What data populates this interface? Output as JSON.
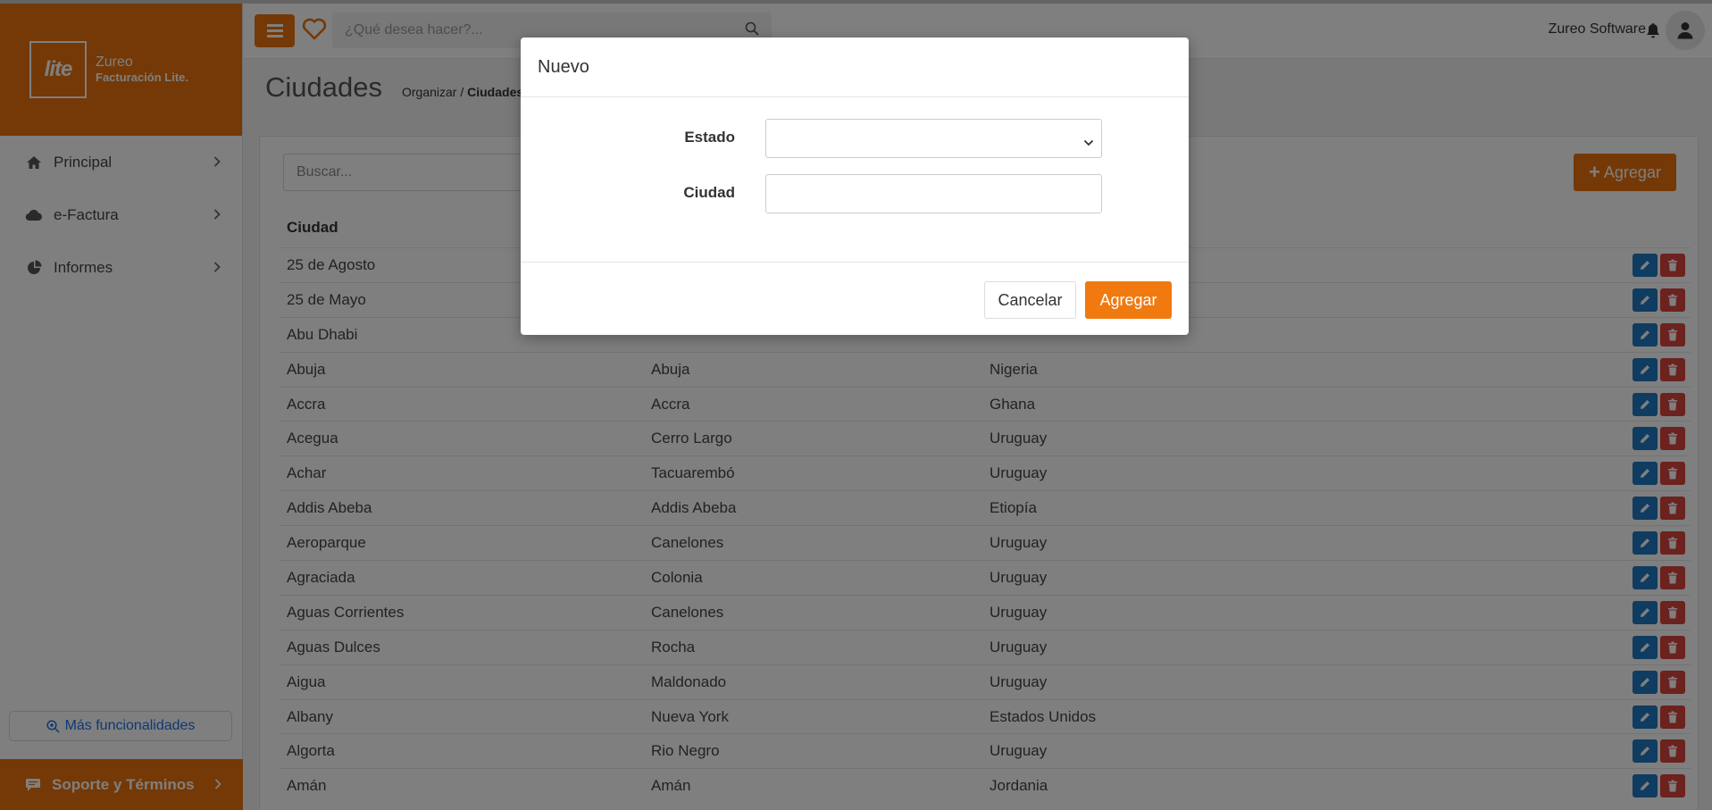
{
  "brand": {
    "logo_text": "lite",
    "name": "Zureo",
    "subtitle": "Facturación Lite."
  },
  "sidebar": {
    "items": [
      {
        "label": "Principal",
        "icon": "home-icon"
      },
      {
        "label": "e-Factura",
        "icon": "cloud-icon"
      },
      {
        "label": "Informes",
        "icon": "pie-chart-icon"
      }
    ],
    "more_label": "Más funcionalidades",
    "support_label": "Soporte y Términos"
  },
  "header": {
    "search_placeholder": "¿Qué desea hacer?...",
    "user_name": "Zureo Software"
  },
  "page": {
    "title": "Ciudades",
    "breadcrumb_parent": "Organizar /",
    "breadcrumb_current": "Ciudades",
    "filter_placeholder": "Buscar...",
    "add_label": "Agregar",
    "column_city": "Ciudad"
  },
  "table": {
    "rows": [
      {
        "c1": "25 de Agosto",
        "c2": "",
        "c3": ""
      },
      {
        "c1": "25 de Mayo",
        "c2": "",
        "c3": ""
      },
      {
        "c1": "Abu Dhabi",
        "c2": "",
        "c3": ""
      },
      {
        "c1": "Abuja",
        "c2": "Abuja",
        "c3": "Nigeria"
      },
      {
        "c1": "Accra",
        "c2": "Accra",
        "c3": "Ghana"
      },
      {
        "c1": "Acegua",
        "c2": "Cerro Largo",
        "c3": "Uruguay"
      },
      {
        "c1": "Achar",
        "c2": "Tacuarembó",
        "c3": "Uruguay"
      },
      {
        "c1": "Addis Abeba",
        "c2": "Addis Abeba",
        "c3": "Etiopía"
      },
      {
        "c1": "Aeroparque",
        "c2": "Canelones",
        "c3": "Uruguay"
      },
      {
        "c1": "Agraciada",
        "c2": "Colonia",
        "c3": "Uruguay"
      },
      {
        "c1": "Aguas Corrientes",
        "c2": "Canelones",
        "c3": "Uruguay"
      },
      {
        "c1": "Aguas Dulces",
        "c2": "Rocha",
        "c3": "Uruguay"
      },
      {
        "c1": "Aigua",
        "c2": "Maldonado",
        "c3": "Uruguay"
      },
      {
        "c1": "Albany",
        "c2": "Nueva York",
        "c3": "Estados Unidos"
      },
      {
        "c1": "Algorta",
        "c2": "Rio Negro",
        "c3": "Uruguay"
      },
      {
        "c1": "Amán",
        "c2": "Amán",
        "c3": "Jordania"
      }
    ]
  },
  "modal": {
    "title": "Nuevo",
    "estado_label": "Estado",
    "estado_value": "",
    "ciudad_label": "Ciudad",
    "ciudad_value": "",
    "cancel_label": "Cancelar",
    "add_label": "Agregar"
  },
  "colors": {
    "accent": "#e8720c",
    "edit": "#1f78c1",
    "delete": "#d9453d"
  }
}
